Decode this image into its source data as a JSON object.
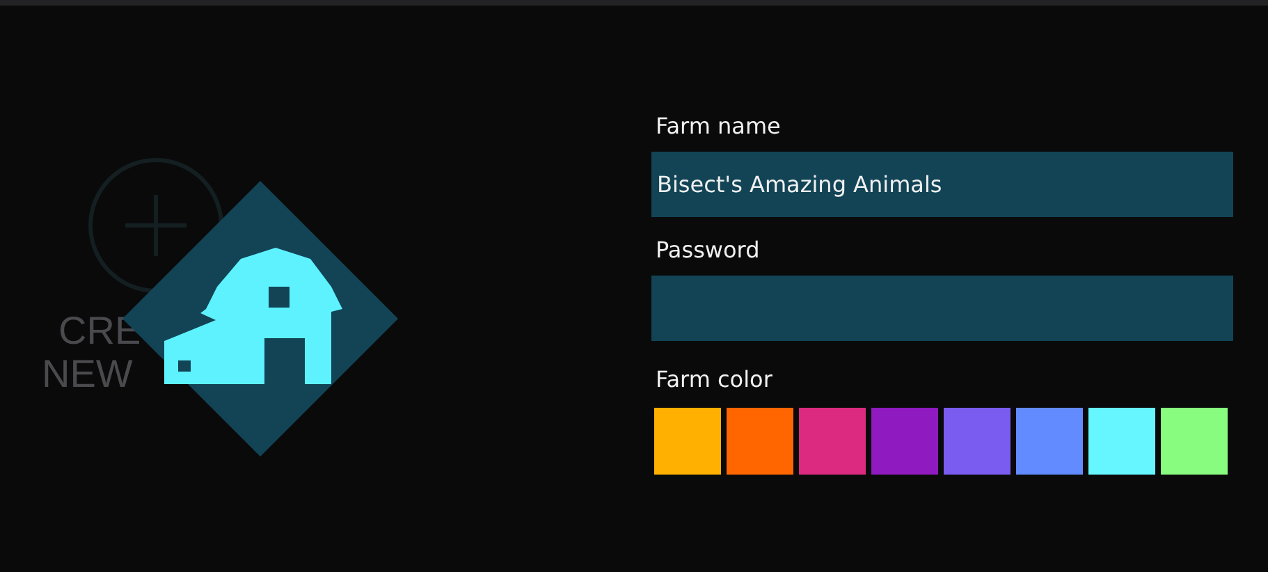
{
  "create_farm": {
    "label_lines": [
      "CRE",
      "NEW"
    ]
  },
  "form": {
    "name_label": "Farm name",
    "name_value": "Bisect's Amazing Animals",
    "password_label": "Password",
    "color_label": "Farm color",
    "colors": [
      {
        "color": "#ffb000",
        "selected": false
      },
      {
        "color": "#ff6600",
        "selected": false
      },
      {
        "color": "#dc2a80",
        "selected": false
      },
      {
        "color": "#8e1ac0",
        "selected": false
      },
      {
        "color": "#7b5cf0",
        "selected": false
      },
      {
        "color": "#628bff",
        "selected": false
      },
      {
        "color": "#66f6ff",
        "selected": false
      },
      {
        "color": "#88fc7e",
        "selected": false
      }
    ]
  }
}
